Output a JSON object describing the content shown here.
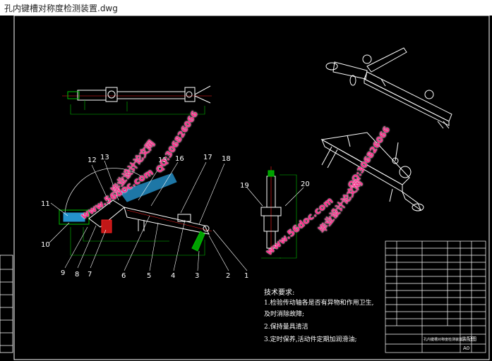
{
  "window": {
    "title": "孔内键槽对称度检测装置.dwg"
  },
  "drawing": {
    "part_numbers": [
      "1",
      "2",
      "3",
      "4",
      "5",
      "6",
      "7",
      "8",
      "9",
      "10",
      "11",
      "12",
      "13",
      "15",
      "16",
      "17",
      "18",
      "19",
      "20"
    ],
    "tech_requirements": {
      "heading": "技术要求:",
      "line1": "1.检验传动轴各是否有异物和作用卫生,",
      "line1b": "及时消除故障;",
      "line2": "2.保持量具清洁",
      "line3": "3.定时保养,活动件定期加润滑油;"
    },
    "watermarks": {
      "site": "www.56doc.com",
      "qq": "QQ:306826066",
      "brand": "毕业设计论文网"
    },
    "title_block": {
      "drawing_name": "孔内键槽对称度检测装置",
      "sheet_size": "A0",
      "label": "装配图"
    },
    "colors": {
      "background": "#000000",
      "outline": "#ffffff",
      "dimension": "#00c000",
      "centerline": "#ff2020",
      "highlight": "#2fb7ff",
      "watermark": "#ff2a8a"
    }
  }
}
